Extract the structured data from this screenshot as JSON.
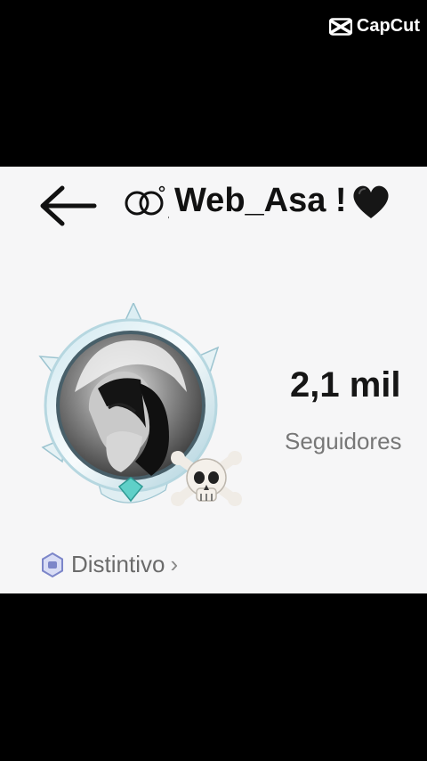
{
  "watermark": {
    "text": "CapCut"
  },
  "header": {
    "username": "Web_Asa !"
  },
  "stats": {
    "value": "2,1 mil",
    "label": "Seguidores"
  },
  "badge": {
    "label": "Distintivo",
    "chevron": "›"
  },
  "icons": [
    "capcut-logo-icon",
    "back-arrow-icon",
    "rings-icon",
    "black-heart-icon",
    "skull-crossbones-icon",
    "badge-icon",
    "chevron-right-icon"
  ]
}
